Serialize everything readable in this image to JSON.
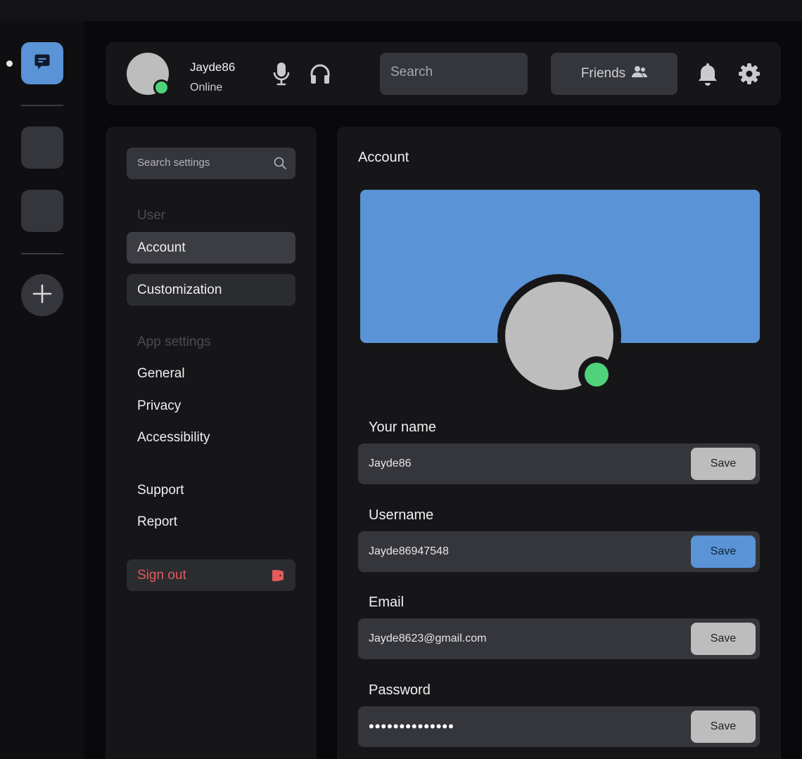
{
  "header": {
    "username": "Jayde86",
    "status": "Online",
    "search_placeholder": "Search",
    "friends_label": "Friends"
  },
  "settings_nav": {
    "search_placeholder": "Search settings",
    "section_user": "User",
    "items_user": [
      "Account",
      "Customization"
    ],
    "section_app": "App settings",
    "items_app": [
      "General",
      "Privacy",
      "Accessibility"
    ],
    "items_other": [
      "Support",
      "Report"
    ],
    "sign_out": "Sign out"
  },
  "account": {
    "title": "Account",
    "fields": [
      {
        "label": "Your name",
        "value": "Jayde86",
        "button": "Save"
      },
      {
        "label": "Username",
        "value": "Jayde86947548",
        "button": "Save"
      },
      {
        "label": "Email",
        "value": "Jayde8623@gmail.com",
        "button": "Save"
      },
      {
        "label": "Password",
        "value": "••••••••••••••",
        "button": "Save"
      }
    ]
  },
  "colors": {
    "accent": "#5a93d6",
    "online": "#4fd27b",
    "danger": "#e35b5b"
  },
  "icons": [
    "chat-icon",
    "plus-icon",
    "microphone-icon",
    "headphones-icon",
    "friends-icon",
    "bell-icon",
    "gear-icon",
    "search-icon",
    "door-icon"
  ]
}
